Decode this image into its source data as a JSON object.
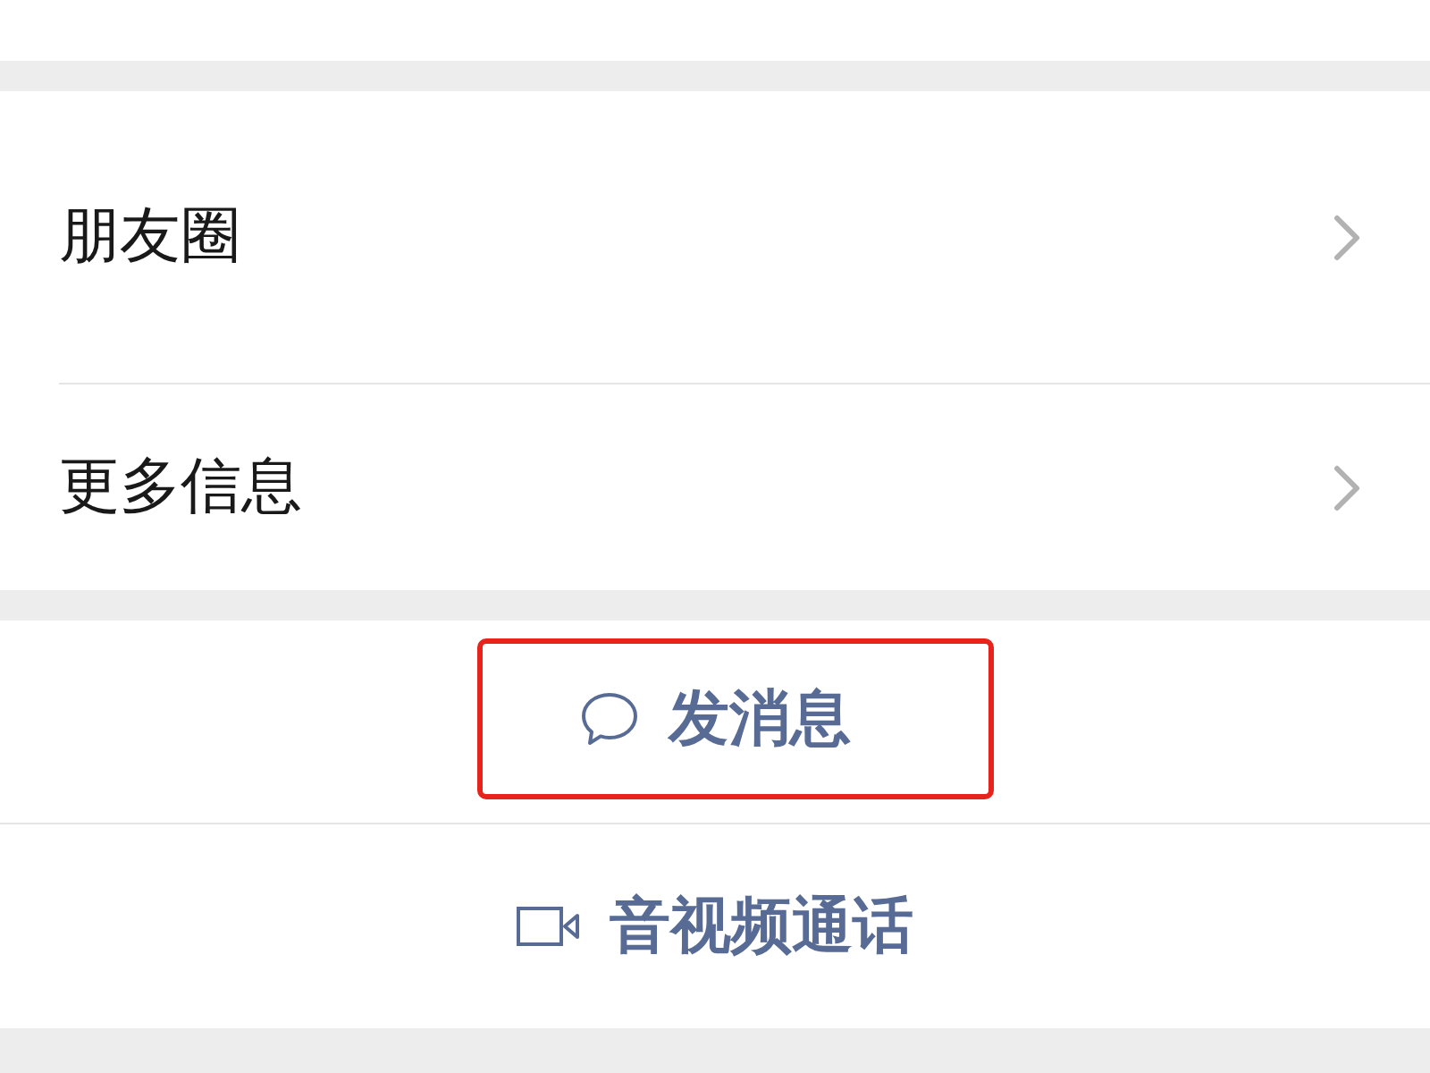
{
  "list_items": [
    {
      "label": "朋友圈"
    },
    {
      "label": "更多信息"
    }
  ],
  "actions": [
    {
      "label": "发消息",
      "kind": "message",
      "highlighted": true
    },
    {
      "label": "音视频通话",
      "kind": "call",
      "highlighted": false
    }
  ]
}
